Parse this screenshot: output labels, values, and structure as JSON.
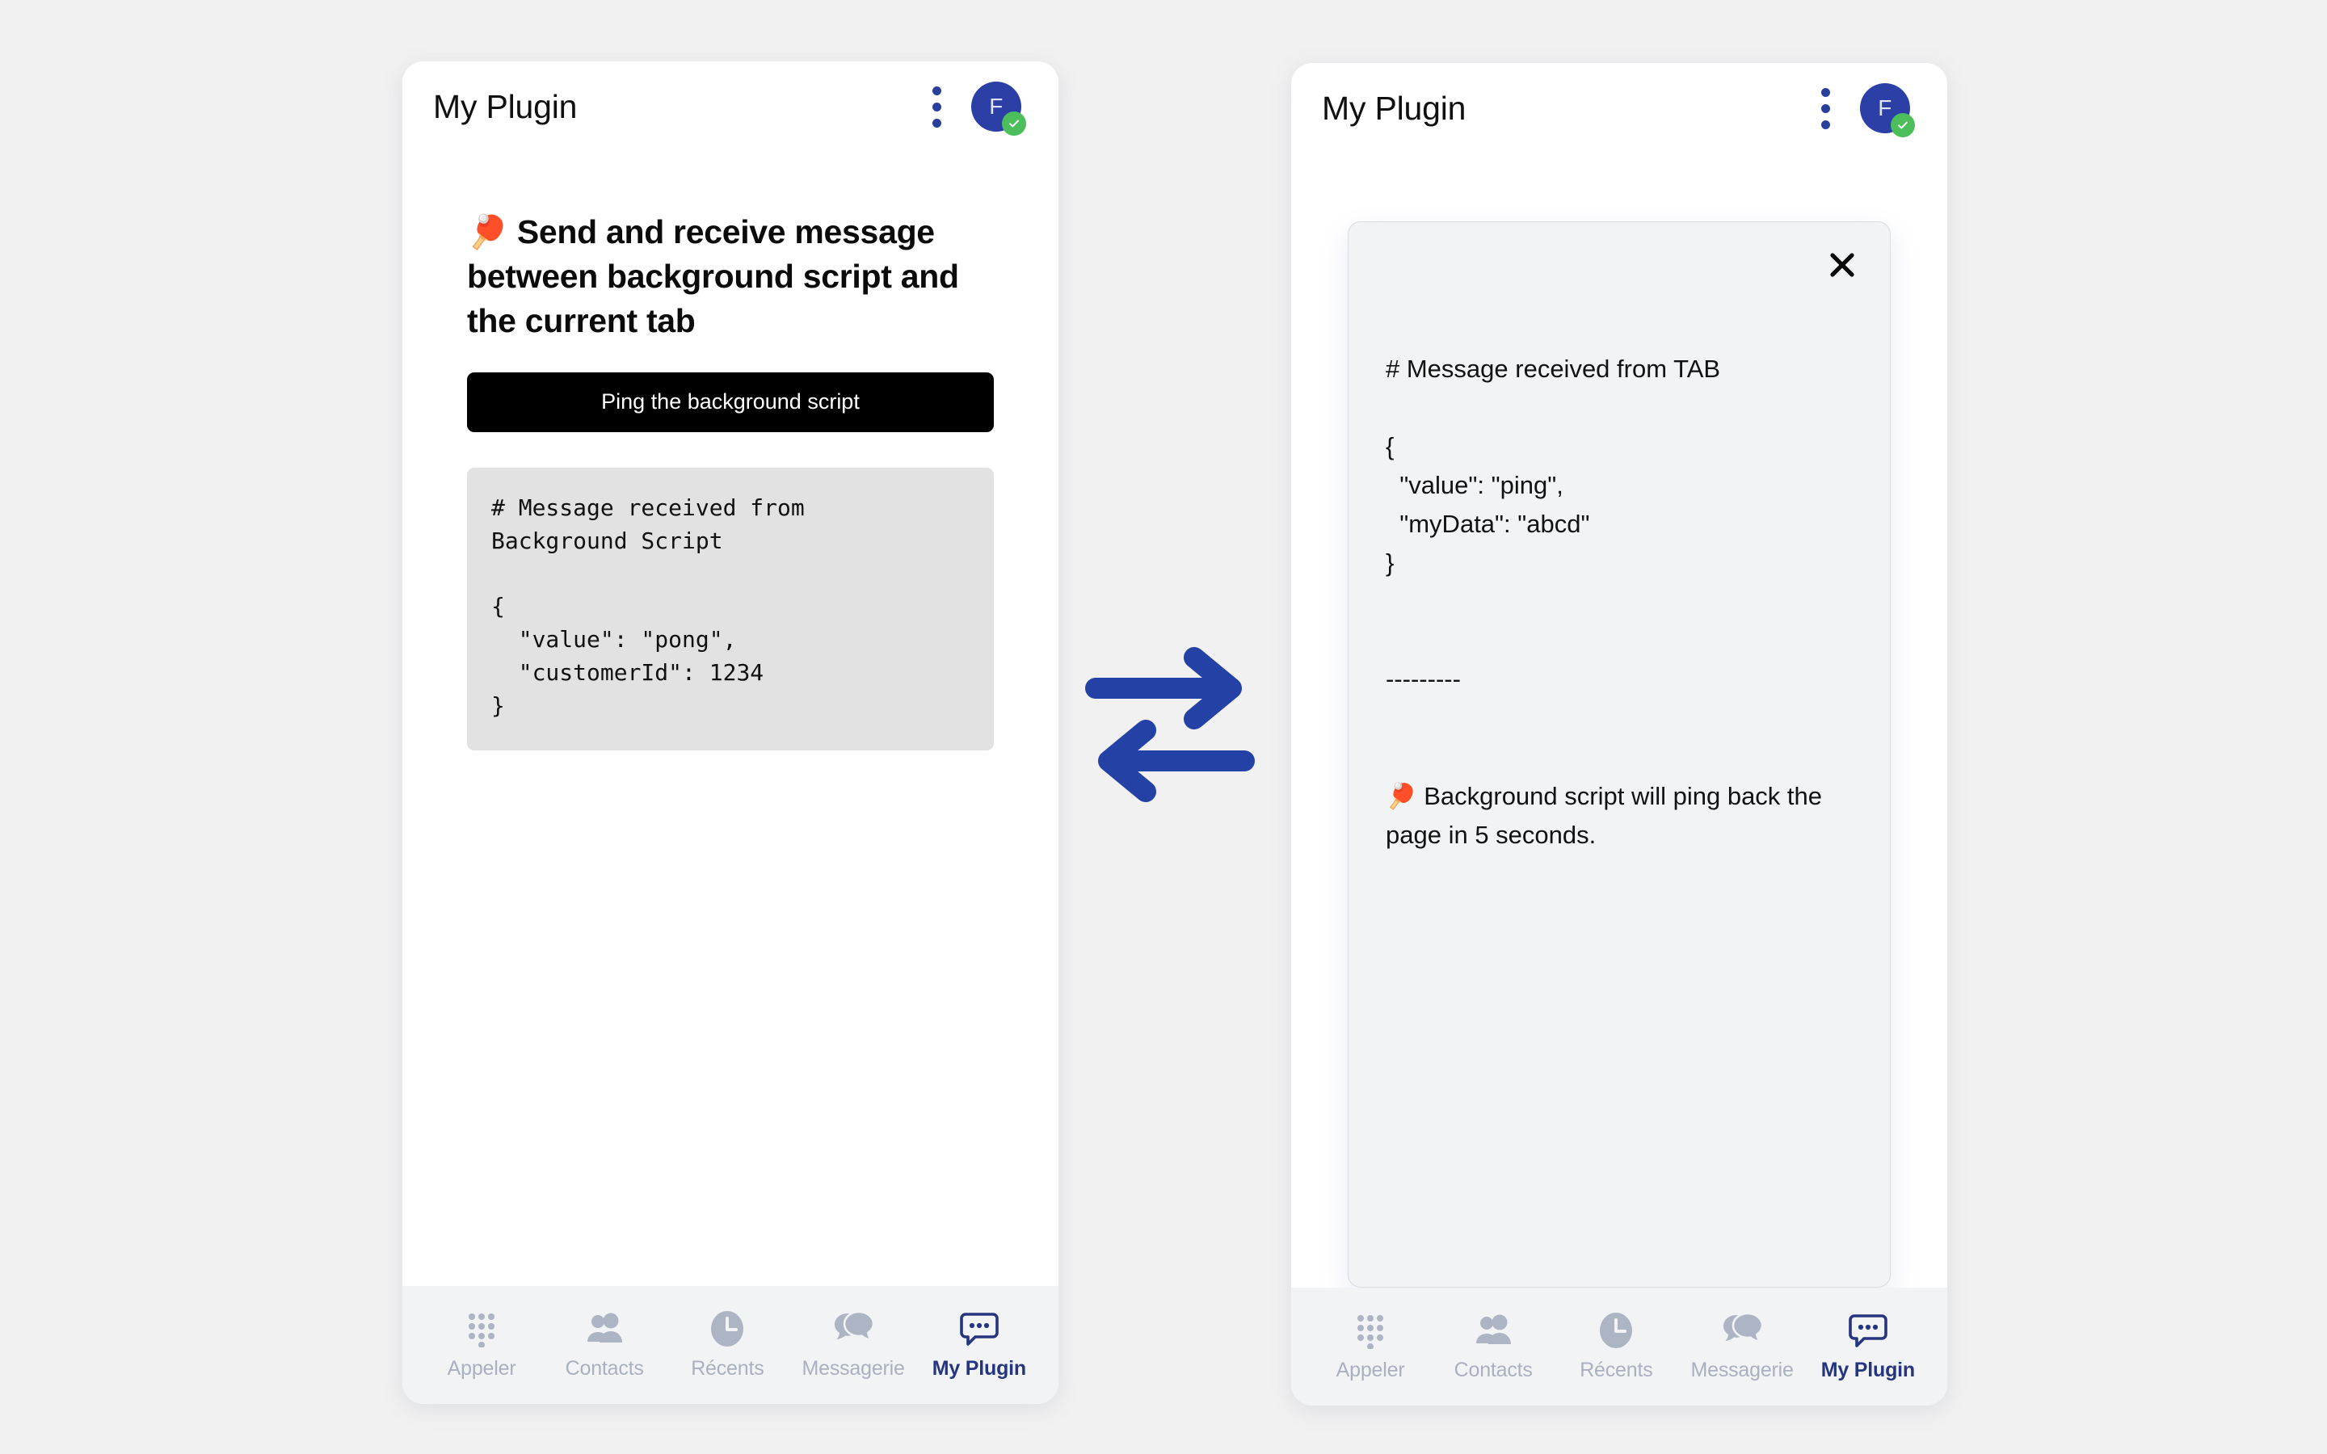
{
  "canvas": {
    "background": "#f1f1f1",
    "accent_blue": "#28409b",
    "avatar_blue": "#2b3fa6",
    "badge_green": "#4cbe5c",
    "nav_inactive": "#a9b0bf",
    "nav_active": "#26357f"
  },
  "left_panel": {
    "header": {
      "title": "My Plugin",
      "menu_icon": "kebab-menu-icon",
      "avatar_initial": "F",
      "avatar_badge_icon": "check-icon"
    },
    "headline": "🏓 Send and receive message between background script and the current tab",
    "ping_button_label": "Ping the background script",
    "code_block": "# Message received from\nBackground Script\n\n{\n  \"value\": \"pong\",\n  \"customerId\": 1234\n}"
  },
  "right_panel": {
    "header": {
      "title": "My Plugin",
      "menu_icon": "kebab-menu-icon",
      "avatar_initial": "F",
      "avatar_badge_icon": "check-icon"
    },
    "modal": {
      "close_icon": "close-icon",
      "body": "# Message received from TAB\n\n{\n  \"value\": \"ping\",\n  \"myData\": \"abcd\"\n}\n\n\n---------\n\n\n🏓 Background script will ping back the page in 5 seconds."
    }
  },
  "bottom_nav": {
    "items": [
      {
        "label": "Appeler",
        "icon": "dialpad-icon",
        "active": false
      },
      {
        "label": "Contacts",
        "icon": "people-icon",
        "active": false
      },
      {
        "label": "Récents",
        "icon": "clock-icon",
        "active": false
      },
      {
        "label": "Messagerie",
        "icon": "chat-bubbles-icon",
        "active": false
      },
      {
        "label": "My Plugin",
        "icon": "speech-bubble-dots-icon",
        "active": true
      }
    ]
  },
  "center_graphic": {
    "icon": "bidirectional-arrows-icon",
    "color": "#2441a5"
  }
}
